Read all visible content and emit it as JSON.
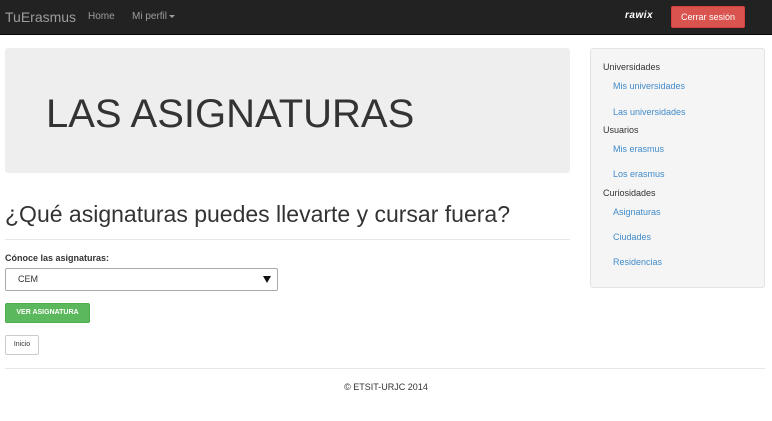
{
  "navbar": {
    "brand": "TuErasmus",
    "home": "Home",
    "profile": "Mi perfil",
    "username": "rawix",
    "logout": "Cerrar sesión"
  },
  "jumbotron": {
    "title": "LAS ASIGNATURAS"
  },
  "main": {
    "heading": "¿Qué asignaturas puedes llevarte y cursar fuera?",
    "select_label": "Cónoce las asignaturas:",
    "select_value": "CEM",
    "submit_button": "VER ASIGNATURA",
    "back_button": "Inicio"
  },
  "sidebar": {
    "groups": [
      {
        "heading": "Universidades",
        "links": [
          "Mis universidades",
          "Las universidades"
        ]
      },
      {
        "heading": "Usuarios",
        "links": [
          "Mis erasmus",
          "Los erasmus"
        ]
      },
      {
        "heading": "Curiosidades",
        "links": [
          "Asignaturas",
          "Ciudades",
          "Residencias"
        ]
      }
    ]
  },
  "footer": {
    "text": "© ETSIT-URJC 2014"
  },
  "colors": {
    "navbar_bg": "#222222",
    "danger": "#d9534f",
    "success": "#5cb85c",
    "link": "#428bca"
  }
}
